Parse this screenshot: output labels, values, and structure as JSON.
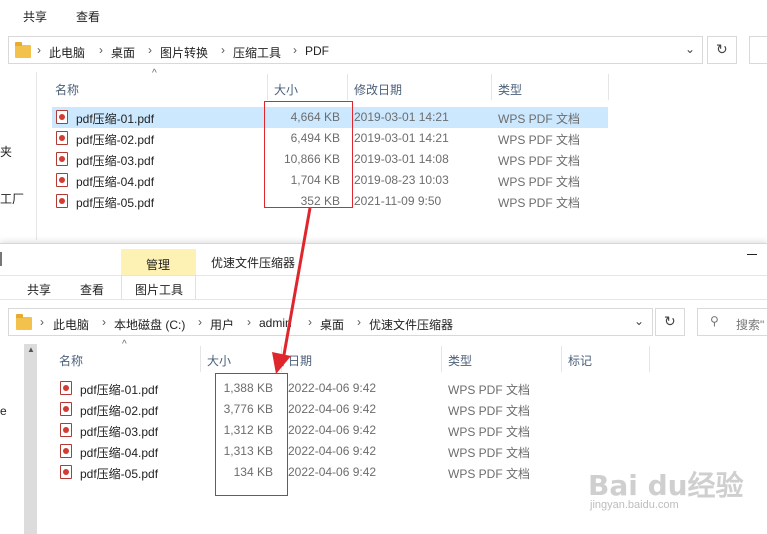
{
  "top_window": {
    "ribbon_tabs": [
      "共享",
      "查看"
    ],
    "breadcrumb": [
      "此电脑",
      "桌面",
      "图片转换",
      "压缩工具",
      "PDF"
    ],
    "columns": {
      "name": "名称",
      "size": "大小",
      "modified": "修改日期",
      "type": "类型"
    },
    "left_nav_fragments": [
      "夹",
      "工厂"
    ],
    "files": [
      {
        "name": "pdf压缩-01.pdf",
        "size": "4,664 KB",
        "date": "2019-03-01 14:21",
        "type": "WPS PDF 文档"
      },
      {
        "name": "pdf压缩-02.pdf",
        "size": "6,494 KB",
        "date": "2019-03-01 14:21",
        "type": "WPS PDF 文档"
      },
      {
        "name": "pdf压缩-03.pdf",
        "size": "10,866 KB",
        "date": "2019-03-01 14:08",
        "type": "WPS PDF 文档"
      },
      {
        "name": "pdf压缩-04.pdf",
        "size": "1,704 KB",
        "date": "2019-08-23 10:03",
        "type": "WPS PDF 文档"
      },
      {
        "name": "pdf压缩-05.pdf",
        "size": "352 KB",
        "date": "2021-11-09 9:50",
        "type": "WPS PDF 文档"
      }
    ]
  },
  "bottom_window": {
    "context_tab": "管理",
    "context_subtab": "图片工具",
    "title": "优速文件压缩器",
    "ribbon_tabs": [
      "共享",
      "查看"
    ],
    "breadcrumb": [
      "此电脑",
      "本地磁盘 (C:)",
      "用户",
      "admin",
      "桌面",
      "优速文件压缩器"
    ],
    "search_placeholder": "搜索\"",
    "columns": {
      "name": "名称",
      "size": "大小",
      "date": "日期",
      "type": "类型",
      "tags": "标记"
    },
    "files": [
      {
        "name": "pdf压缩-01.pdf",
        "size": "1,388 KB",
        "date": "2022-04-06 9:42",
        "type": "WPS PDF 文档"
      },
      {
        "name": "pdf压缩-02.pdf",
        "size": "3,776 KB",
        "date": "2022-04-06 9:42",
        "type": "WPS PDF 文档"
      },
      {
        "name": "pdf压缩-03.pdf",
        "size": "1,312 KB",
        "date": "2022-04-06 9:42",
        "type": "WPS PDF 文档"
      },
      {
        "name": "pdf压缩-04.pdf",
        "size": "1,313 KB",
        "date": "2022-04-06 9:42",
        "type": "WPS PDF 文档"
      },
      {
        "name": "pdf压缩-05.pdf",
        "size": "134 KB",
        "date": "2022-04-06 9:42",
        "type": "WPS PDF 文档"
      }
    ]
  },
  "watermark": {
    "brand": "Bai du经验",
    "url": "jingyan.baidu.com"
  },
  "colors": {
    "highlight_box": "#e0262d",
    "selected_row": "#cce8ff",
    "context_tab": "#fdf2b3"
  }
}
